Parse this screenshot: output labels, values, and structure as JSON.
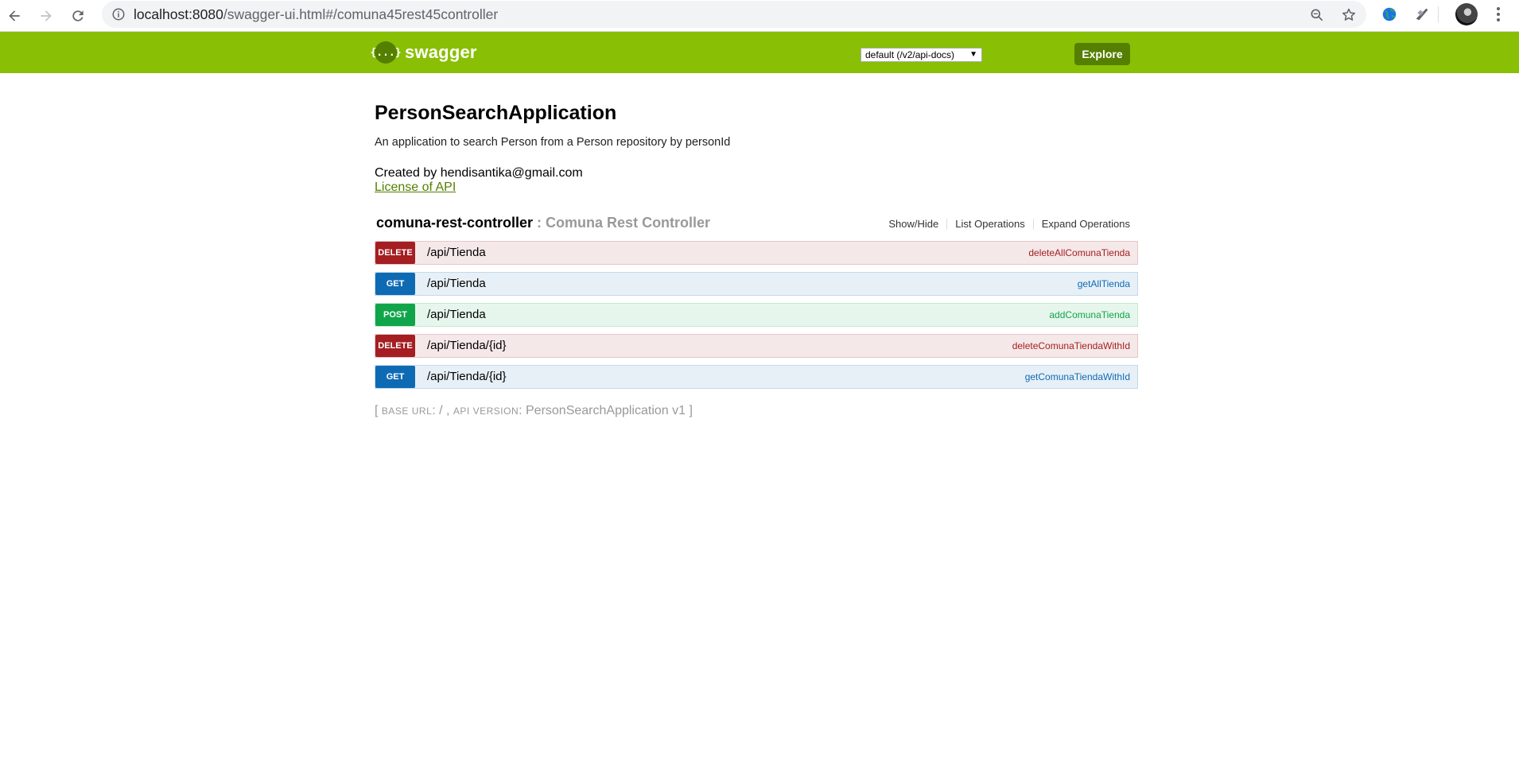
{
  "browser": {
    "url_host": "localhost:8080",
    "url_path": "/swagger-ui.html#/comuna45rest45controller"
  },
  "header": {
    "logo_glyph": "{...}",
    "logo_text": "swagger",
    "spec_selected": "default (/v2/api-docs)",
    "explore_label": "Explore",
    "brand_color": "#89bf04"
  },
  "info": {
    "title": "PersonSearchApplication",
    "description": "An application to search Person from a Person repository by personId",
    "contact": "Created by hendisantika@gmail.com",
    "license": "License of API"
  },
  "resource": {
    "name": "comuna-rest-controller",
    "separator": " : ",
    "description": "Comuna Rest Controller",
    "show_hide": "Show/Hide",
    "list_operations": "List Operations",
    "expand_operations": "Expand Operations",
    "operations": [
      {
        "method": "DELETE",
        "path": "/api/Tienda",
        "nickname": "deleteAllComunaTienda"
      },
      {
        "method": "GET",
        "path": "/api/Tienda",
        "nickname": "getAllTienda"
      },
      {
        "method": "POST",
        "path": "/api/Tienda",
        "nickname": "addComunaTienda"
      },
      {
        "method": "DELETE",
        "path": "/api/Tienda/{id}",
        "nickname": "deleteComunaTiendaWithId"
      },
      {
        "method": "GET",
        "path": "/api/Tienda/{id}",
        "nickname": "getComunaTiendaWithId"
      }
    ]
  },
  "footer": {
    "open": "[ ",
    "base_url_label": "base url",
    "base_url_value": ": / , ",
    "api_version_label": "api version",
    "api_version_value": ": PersonSearchApplication v1 ]"
  }
}
